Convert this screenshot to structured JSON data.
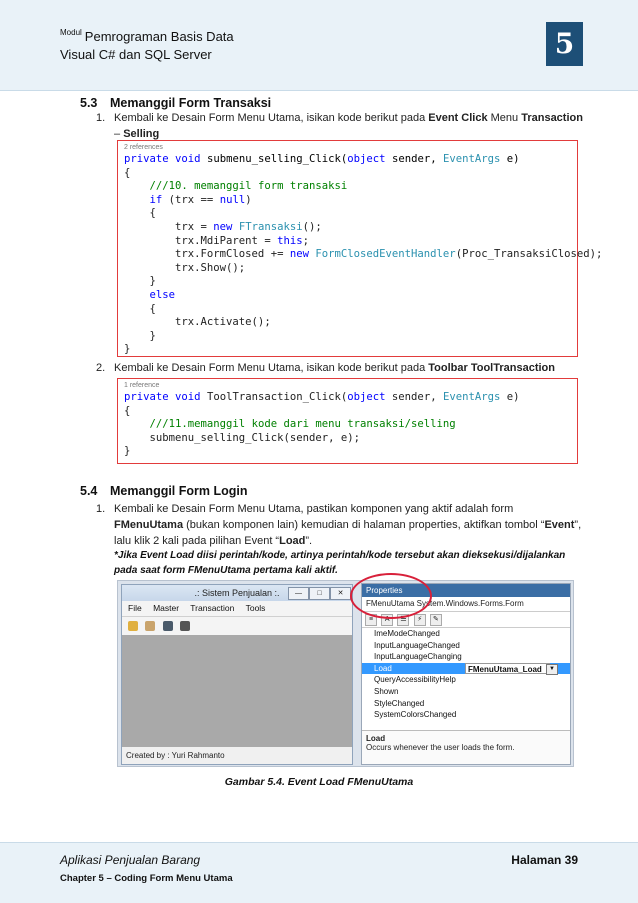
{
  "header": {
    "sup": "Modul",
    "line1": "Pemrograman Basis Data",
    "line2": "Visual C# dan SQL Server",
    "chapter_number": "5"
  },
  "sec53": {
    "num": "5.3",
    "title": "Memanggil Form Transaksi",
    "item1": {
      "n": "1.",
      "a": "Kembali ke Desain Form Menu Utama, isikan kode berikut pada ",
      "b": "Event Click",
      "c": " Menu ",
      "d": "Transaction",
      "e": " – ",
      "f": "Selling"
    },
    "code1_ref": "2 references",
    "item2": {
      "n": "2.",
      "a": "Kembali ke Desain Form Menu Utama, isikan kode berikut pada ",
      "b": "Toolbar ToolTransaction"
    },
    "code2_ref": "1 reference"
  },
  "sec54": {
    "num": "5.4",
    "title": "Memanggil Form Login",
    "item1": {
      "n": "1.",
      "a": "Kembali ke Desain Form Menu Utama, pastikan komponen yang aktif adalah form ",
      "b": "FMenuUtama",
      "c": " (bukan komponen lain) kemudian di halaman properties, aktifkan tombol “",
      "d": "Event",
      "e": "”, lalu klik 2 kali pada pilihan Event “",
      "f": "Load",
      "g": "”."
    },
    "note": "*Jika Event Load diisi perintah/kode, artinya perintah/kode tersebut akan dieksekusi/dijalankan pada saat form FMenuUtama pertama kali aktif."
  },
  "screenshot": {
    "form_title": ".: Sistem Penjualan :.",
    "menu": [
      "File",
      "Master",
      "Transaction",
      "Tools"
    ],
    "status": "Created by : Yuri Rahmanto",
    "props_title": "Properties",
    "props_object": "FMenuUtama System.Windows.Forms.Form",
    "events": [
      "ImeModeChanged",
      "InputLanguageChanged",
      "InputLanguageChanging",
      "Load",
      "QueryAccessibilityHelp",
      "Shown",
      "StyleChanged",
      "SystemColorsChanged"
    ],
    "load_value": "FMenuUtama_Load",
    "desc_title": "Load",
    "desc_text": "Occurs whenever the user loads the form."
  },
  "caption": "Gambar 5.4. Event Load FMenuUtama",
  "footer": {
    "left1": "Aplikasi Penjualan Barang",
    "left2": "Chapter 5 – Coding Form Menu Utama",
    "right": "Halaman 39"
  }
}
